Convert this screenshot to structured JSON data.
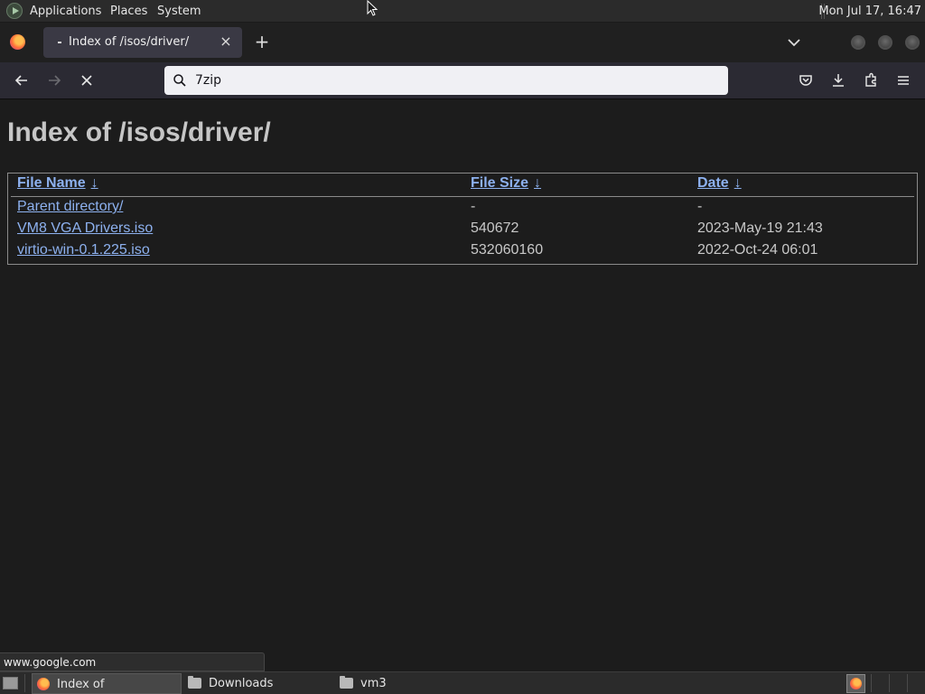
{
  "top_panel": {
    "menus": [
      "Applications",
      "Places",
      "System"
    ],
    "clock": "Mon Jul 17, 16:47"
  },
  "browser": {
    "tab": {
      "title": "Index of /isos/driver/",
      "close": "×"
    },
    "new_tab": "+",
    "urlbar": {
      "value": "7zip",
      "placeholder": ""
    }
  },
  "page": {
    "title": "Index of /isos/driver/",
    "columns": [
      {
        "label": "File Name",
        "arrow": "↓"
      },
      {
        "label": "File Size",
        "arrow": "↓"
      },
      {
        "label": "Date",
        "arrow": "↓"
      }
    ],
    "rows": [
      {
        "name": "Parent directory/",
        "size": "-",
        "date": "-"
      },
      {
        "name": "VM8 VGA Drivers.iso",
        "size": "540672",
        "date": "2023-May-19 21:43"
      },
      {
        "name": "virtio-win-0.1.225.iso",
        "size": "532060160",
        "date": "2022-Oct-24 06:01"
      }
    ]
  },
  "status_url": "www.google.com",
  "taskbar": {
    "tasks": [
      "Index of /isos/driver...",
      "Downloads",
      "vm3"
    ]
  },
  "colors": {
    "link": "#8db1ef",
    "page_bg": "#1c1c1c",
    "toolbar_bg": "#2b2a33"
  }
}
